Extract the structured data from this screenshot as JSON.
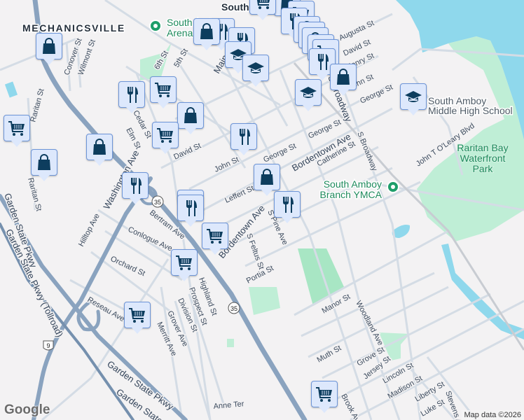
{
  "map": {
    "places": {
      "town": "MECHANICSVILLE",
      "city": "South Amboy"
    },
    "pois": {
      "arena": [
        "South Amboy",
        "Arena"
      ],
      "ymca": [
        "South Amboy",
        "Branch YMCA"
      ],
      "school": [
        "South Amboy",
        "Middle High School"
      ],
      "park": [
        "Raritan Bay",
        "Waterfront",
        "Park"
      ]
    },
    "streets": {
      "conover": "Conover St",
      "wilmont": "Wilmont St",
      "sixth": "6th St",
      "fifth": "5th St",
      "main": "Main St",
      "cedar": "Cedar St",
      "elm": "Elm St",
      "raritan1": "Raritan St",
      "raritan2": "Raritan St",
      "david1": "David St",
      "john1": "John St",
      "leffert": "Leffert St",
      "george1": "George St",
      "george2": "George St",
      "george3": "George St",
      "bordentown1": "Bordentown Ave",
      "bordentown2": "Bordentown Ave",
      "catherine": "Catherine St",
      "broadway1": "S Broadway",
      "broadway2": "S Broadway",
      "augusta": "Augusta St",
      "david2": "David St",
      "henry": "Henry St",
      "john2": "John St",
      "oleary": "John T O'Leary Blvd",
      "washington": "Washington Ave",
      "hilltop": "Hilltop Ave",
      "bertram": "Bertram Ave",
      "conlogue": "Conlogue Ave",
      "orchard": "Orchard St",
      "reseau": "Reseau Ave",
      "highland": "Highland St",
      "prospect": "Prospect St",
      "division": "Division St",
      "grover": "Grover Ave",
      "merritt": "Merritt Ave",
      "feltus": "S Feltus St",
      "pine": "S Pine Ave",
      "portia": "Portia St",
      "manor": "Manor St",
      "woodland": "Woodland Ave",
      "muth": "Muth St",
      "grove": "Grove St",
      "jersey": "Jersey St",
      "lincoln": "Lincoln St",
      "madison": "Madison St",
      "liberty": "Liberty St",
      "luke": "Luke St",
      "stevens": "Stevens Ave",
      "brook": "Brook Ave",
      "anne": "Anne Ter",
      "gsp1": "Garden State Pkwy",
      "gsp2": "Garden State Pkwy (Tollroad)",
      "gsp3": "Garden State Pkwy",
      "gsp4": "Garden State Pkwy"
    },
    "routes": {
      "r35": "35",
      "us9": "9"
    },
    "marker_types": [
      "shopping-bag",
      "restaurant",
      "school",
      "grocery-cart"
    ],
    "colors": {
      "water": "#8fd8ec",
      "park": "#bfeed6",
      "highway": "#8aa3bf",
      "marker_bg": "#dde8fc",
      "marker_icon": "#0d3d5e"
    }
  },
  "footer": {
    "logo": "Google",
    "attribution": "Map data ©2026"
  }
}
